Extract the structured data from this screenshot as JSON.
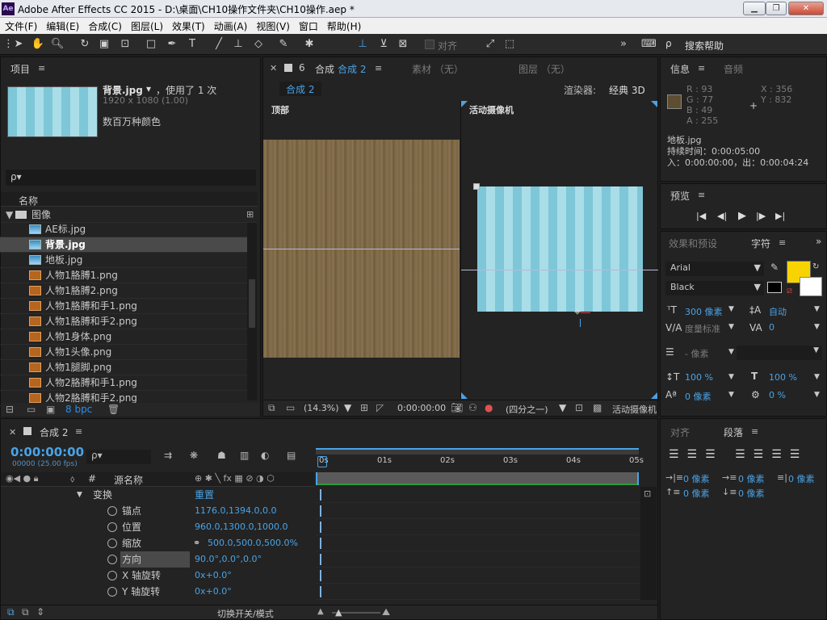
{
  "window": {
    "title": "Adobe After Effects CC 2015 - D:\\桌面\\CH10操作文件夹\\CH10操作.aep *",
    "logo": "Ae"
  },
  "menu": [
    "文件(F)",
    "编辑(E)",
    "合成(C)",
    "图层(L)",
    "效果(T)",
    "动画(A)",
    "视图(V)",
    "窗口",
    "帮助(H)"
  ],
  "toolbar": {
    "align_label": "对齐",
    "search_help": "搜索帮助",
    "more": "»"
  },
  "project": {
    "tab": "项目",
    "file_name": "背景.jpg",
    "usage": "，使用了 1 次",
    "dimensions": "1920 x 1080 (1.00)",
    "colors": "数百万种颜色",
    "search_placeholder": "ρ▾",
    "col_name": "名称",
    "folder": "图像",
    "items": [
      {
        "name": "AE标.jpg",
        "type": "image",
        "selected": false
      },
      {
        "name": "背景.jpg",
        "type": "image",
        "selected": true
      },
      {
        "name": "地板.jpg",
        "type": "image",
        "selected": false
      },
      {
        "name": "人物1胳膊1.png",
        "type": "png",
        "selected": false
      },
      {
        "name": "人物1胳膊2.png",
        "type": "png",
        "selected": false
      },
      {
        "name": "人物1胳膊和手1.png",
        "type": "png",
        "selected": false
      },
      {
        "name": "人物1胳膊和手2.png",
        "type": "png",
        "selected": false
      },
      {
        "name": "人物1身体.png",
        "type": "png",
        "selected": false
      },
      {
        "name": "人物1头像.png",
        "type": "png",
        "selected": false
      },
      {
        "name": "人物1腿脚.png",
        "type": "png",
        "selected": false
      },
      {
        "name": "人物2胳膊和手1.png",
        "type": "png",
        "selected": false
      },
      {
        "name": "人物2胳膊和手2.png",
        "type": "png",
        "selected": false
      }
    ],
    "bpc": "8 bpc"
  },
  "comp": {
    "tab_prefix": "合成",
    "tab_name": "合成 2",
    "footage_tab": "素材 （无）",
    "layer_tab": "图层 （无）",
    "crumb": "合成 2",
    "renderer_label": "渲染器:",
    "renderer": "经典 3D",
    "view_left": "顶部",
    "view_right": "活动摄像机",
    "footer": {
      "zoom": "(14.3%)",
      "time": "0:00:00:00",
      "resolution": "(四分之一)",
      "view": "活动摄像机"
    }
  },
  "info": {
    "tab": "信息",
    "audio_tab": "音频",
    "r": "R : 93",
    "g": "G : 77",
    "b": "B : 49",
    "a": "A : 255",
    "x": "X : 356",
    "y": "Y : 832",
    "swatch": "#5d4d31",
    "layer": "地板.jpg",
    "duration": "持续时间：0:00:05:00",
    "inout": "入：0:00:00:00，出：0:00:04:24"
  },
  "preview": {
    "tab": "预览"
  },
  "character": {
    "effects_tab": "效果和预设",
    "tab": "字符",
    "font": "Arial",
    "style": "Black",
    "fill_color": "#f7d400",
    "size": "300 像素",
    "leading": "自动",
    "kerning": "度量标准",
    "tracking": "0",
    "stroke": "- 像素",
    "vscale": "100 %",
    "hscale": "100 %",
    "baseline": "0 像素",
    "tsume": "0 %"
  },
  "paragraph": {
    "align_tab": "对齐",
    "tab": "段落",
    "indent_left": "0 像素",
    "indent_first": "0 像素",
    "indent_right": "0 像素",
    "space_before": "0 像素",
    "space_after": "0 像素"
  },
  "timeline": {
    "tab": "合成 2",
    "timecode": "0:00:00:00",
    "frames": "00000 (25.00 fps)",
    "col_hash": "#",
    "col_source": "源名称",
    "ruler": [
      "0s",
      "01s",
      "02s",
      "03s",
      "04s",
      "05s"
    ],
    "transform": "变换",
    "reset": "重置",
    "props": [
      {
        "name": "锚点",
        "value": "1176.0,1394.0,0.0"
      },
      {
        "name": "位置",
        "value": "960.0,1300.0,1000.0"
      },
      {
        "name": "缩放",
        "value": "500.0,500.0,500.0%"
      },
      {
        "name": "方向",
        "value": "90.0°,0.0°,0.0°"
      },
      {
        "name": "X 轴旋转",
        "value": "0x+0.0°"
      },
      {
        "name": "Y 轴旋转",
        "value": "0x+0.0°"
      }
    ],
    "toggle": "切换开关/模式"
  }
}
